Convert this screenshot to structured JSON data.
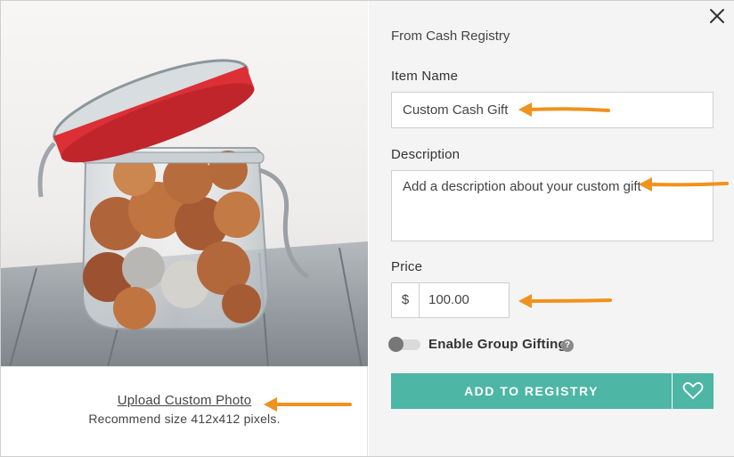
{
  "left": {
    "photo_alt": "Glass jar of coins",
    "upload_link": "Upload Custom Photo",
    "upload_hint": "Recommend size 412x412 pixels."
  },
  "right": {
    "source": "From Cash Registry",
    "item_name_label": "Item Name",
    "item_name_value": "Custom Cash Gift",
    "description_label": "Description",
    "description_placeholder": "Add a description about your custom gift",
    "price_label": "Price",
    "currency_symbol": "$",
    "price_value": "100.00",
    "group_gifting_label": "Enable Group Gifting",
    "group_gifting_enabled": false,
    "help_glyph": "?",
    "add_button": "ADD TO REGISTRY"
  },
  "icons": {
    "close": "close-icon",
    "heart": "heart-icon",
    "help": "question-icon"
  },
  "colors": {
    "accent": "#4db6a4",
    "annotation_arrow": "#f0921e",
    "pane_background": "#f4f4f4"
  }
}
